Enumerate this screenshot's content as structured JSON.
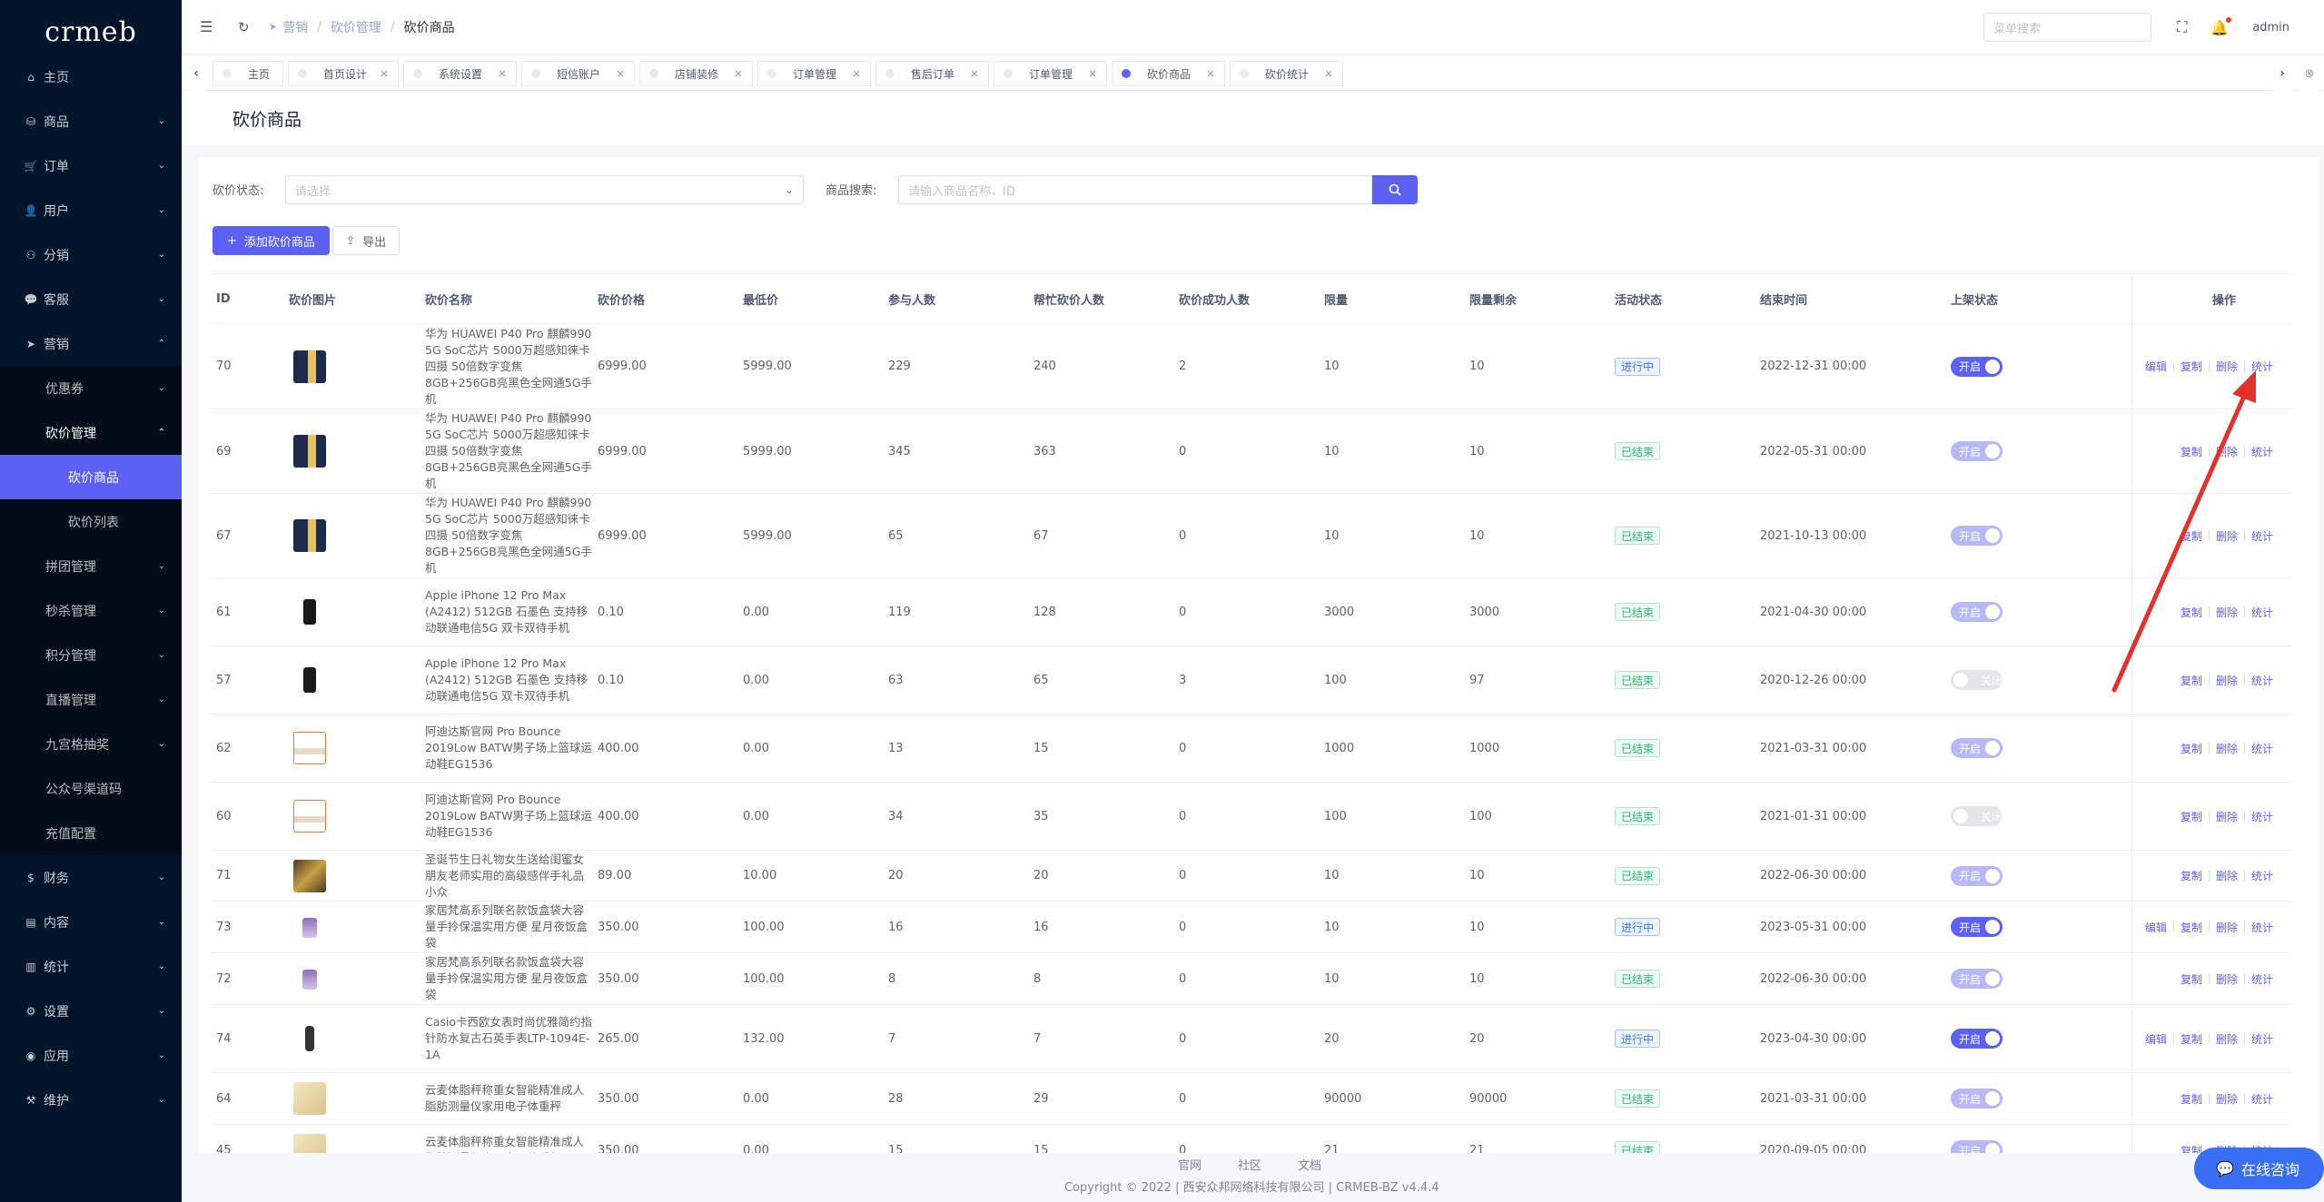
{
  "sidebar": {
    "logo": "crmeb",
    "items": [
      {
        "icon": "⌂",
        "label": "主页",
        "arrow": ""
      },
      {
        "icon": "⛁",
        "label": "商品",
        "arrow": "⌄"
      },
      {
        "icon": "🛒",
        "label": "订单",
        "arrow": "⌄"
      },
      {
        "icon": "👤",
        "label": "用户",
        "arrow": "⌄"
      },
      {
        "icon": "⚇",
        "label": "分销",
        "arrow": "⌄"
      },
      {
        "icon": "💬",
        "label": "客服",
        "arrow": "⌄"
      },
      {
        "icon": "➤",
        "label": "营销",
        "arrow": "⌃"
      }
    ],
    "marketing_sub": [
      {
        "label": "优惠券",
        "arrow": "⌄"
      },
      {
        "label": "砍价管理",
        "arrow": "⌃"
      }
    ],
    "bargain_sub": [
      {
        "label": "砍价商品"
      },
      {
        "label": "砍价列表"
      }
    ],
    "marketing_sub2": [
      {
        "label": "拼团管理",
        "arrow": "⌄"
      },
      {
        "label": "秒杀管理",
        "arrow": "⌄"
      },
      {
        "label": "积分管理",
        "arrow": "⌄"
      },
      {
        "label": "直播管理",
        "arrow": "⌄"
      },
      {
        "label": "九宫格抽奖",
        "arrow": "⌄"
      },
      {
        "label": "公众号渠道码",
        "arrow": ""
      },
      {
        "label": "充值配置",
        "arrow": ""
      }
    ],
    "items2": [
      {
        "icon": "$",
        "label": "财务",
        "arrow": "⌄"
      },
      {
        "icon": "▤",
        "label": "内容",
        "arrow": "⌄"
      },
      {
        "icon": "▥",
        "label": "统计",
        "arrow": "⌄"
      },
      {
        "icon": "⚙",
        "label": "设置",
        "arrow": "⌄"
      },
      {
        "icon": "◉",
        "label": "应用",
        "arrow": "⌄"
      },
      {
        "icon": "⚒",
        "label": "维护",
        "arrow": "⌄"
      }
    ]
  },
  "header": {
    "breadcrumb": [
      "营销",
      "砍价管理",
      "砍价商品"
    ],
    "menu_search_placeholder": "菜单搜索",
    "user": "admin"
  },
  "tabs": [
    {
      "label": "主页",
      "closable": false,
      "active": false
    },
    {
      "label": "首页设计",
      "closable": true,
      "active": false
    },
    {
      "label": "系统设置",
      "closable": true,
      "active": false
    },
    {
      "label": "短信账户",
      "closable": true,
      "active": false
    },
    {
      "label": "店铺装修",
      "closable": true,
      "active": false
    },
    {
      "label": "订单管理",
      "closable": true,
      "active": false
    },
    {
      "label": "售后订单",
      "closable": true,
      "active": false
    },
    {
      "label": "订单管理",
      "closable": true,
      "active": false
    },
    {
      "label": "砍价商品",
      "closable": true,
      "active": true
    },
    {
      "label": "砍价统计",
      "closable": true,
      "active": false
    }
  ],
  "page_title": "砍价商品",
  "filters": {
    "status_label": "砍价状态:",
    "status_placeholder": "请选择",
    "search_label": "商品搜索:",
    "search_placeholder": "请输入商品名称，ID"
  },
  "actions": {
    "add_label": "添加砍价商品",
    "export_label": "导出"
  },
  "table": {
    "headers": [
      "ID",
      "砍价图片",
      "砍价名称",
      "砍价价格",
      "最低价",
      "参与人数",
      "帮忙砍价人数",
      "砍价成功人数",
      "限量",
      "限量剩余",
      "活动状态",
      "结束时间",
      "上架状态",
      "操作"
    ],
    "rows": [
      {
        "id": "70",
        "img": "phone-p40",
        "name": "华为 HUAWEI P40 Pro 麒麟990 5G SoC芯片 5000万超感知徕卡四摄 50倍数字变焦 8GB+256GB亮黑色全网通5G手机",
        "price": "6999.00",
        "min": "5999.00",
        "people": "229",
        "helpers": "240",
        "success": "2",
        "limit": "10",
        "remain": "10",
        "status": "进行中",
        "status_color": "blue",
        "end": "2022-12-31 00:00",
        "switch": "开启",
        "switch_on": true,
        "switch_disabled": false,
        "ops": [
          "编辑",
          "复制",
          "删除",
          "统计"
        ],
        "h": 94
      },
      {
        "id": "69",
        "img": "phone-p40",
        "name": "华为 HUAWEI P40 Pro 麒麟990 5G SoC芯片 5000万超感知徕卡四摄 50倍数字变焦 8GB+256GB亮黑色全网通5G手机",
        "price": "6999.00",
        "min": "5999.00",
        "people": "345",
        "helpers": "363",
        "success": "0",
        "limit": "10",
        "remain": "10",
        "status": "已结束",
        "status_color": "green",
        "end": "2022-05-31 00:00",
        "switch": "开启",
        "switch_on": true,
        "switch_disabled": true,
        "ops": [
          "复制",
          "删除",
          "统计"
        ],
        "h": 93
      },
      {
        "id": "67",
        "img": "phone-p40",
        "name": "华为 HUAWEI P40 Pro 麒麟990 5G SoC芯片 5000万超感知徕卡四摄 50倍数字变焦 8GB+256GB亮黑色全网通5G手机",
        "price": "6999.00",
        "min": "5999.00",
        "people": "65",
        "helpers": "67",
        "success": "0",
        "limit": "10",
        "remain": "10",
        "status": "已结束",
        "status_color": "green",
        "end": "2021-10-13 00:00",
        "switch": "开启",
        "switch_on": true,
        "switch_disabled": true,
        "ops": [
          "复制",
          "删除",
          "统计"
        ],
        "h": 93
      },
      {
        "id": "61",
        "img": "phone-iphone",
        "name": "Apple iPhone 12 Pro Max (A2412) 512GB 石墨色 支持移动联通电信5G 双卡双待手机",
        "price": "0.10",
        "min": "0.00",
        "people": "119",
        "helpers": "128",
        "success": "0",
        "limit": "3000",
        "remain": "3000",
        "status": "已结束",
        "status_color": "green",
        "end": "2021-04-30 00:00",
        "switch": "开启",
        "switch_on": true,
        "switch_disabled": true,
        "ops": [
          "复制",
          "删除",
          "统计"
        ],
        "h": 75
      },
      {
        "id": "57",
        "img": "phone-iphone",
        "name": "Apple iPhone 12 Pro Max (A2412) 512GB 石墨色 支持移动联通电信5G 双卡双待手机",
        "price": "0.10",
        "min": "0.00",
        "people": "63",
        "helpers": "65",
        "success": "3",
        "limit": "100",
        "remain": "97",
        "status": "已结束",
        "status_color": "green",
        "end": "2020-12-26 00:00",
        "switch": "关闭",
        "switch_on": false,
        "switch_disabled": true,
        "ops": [
          "复制",
          "删除",
          "统计"
        ],
        "h": 75
      },
      {
        "id": "62",
        "img": "shoe",
        "name": "阿迪达斯官网 Pro Bounce 2019Low BATW男子场上篮球运动鞋EG1536",
        "price": "400.00",
        "min": "0.00",
        "people": "13",
        "helpers": "15",
        "success": "0",
        "limit": "1000",
        "remain": "1000",
        "status": "已结束",
        "status_color": "green",
        "end": "2021-03-31 00:00",
        "switch": "开启",
        "switch_on": true,
        "switch_disabled": true,
        "ops": [
          "复制",
          "删除",
          "统计"
        ],
        "h": 75
      },
      {
        "id": "60",
        "img": "shoe",
        "name": "阿迪达斯官网 Pro Bounce 2019Low BATW男子场上篮球运动鞋EG1536",
        "price": "400.00",
        "min": "0.00",
        "people": "34",
        "helpers": "35",
        "success": "0",
        "limit": "100",
        "remain": "100",
        "status": "已结束",
        "status_color": "green",
        "end": "2021-01-31 00:00",
        "switch": "关闭",
        "switch_on": false,
        "switch_disabled": true,
        "ops": [
          "复制",
          "删除",
          "统计"
        ],
        "h": 75
      },
      {
        "id": "71",
        "img": "gift",
        "name": "圣诞节生日礼物女生送给闺蜜女朋友老师实用的高级感伴手礼品小众",
        "price": "89.00",
        "min": "10.00",
        "people": "20",
        "helpers": "20",
        "success": "0",
        "limit": "10",
        "remain": "10",
        "status": "已结束",
        "status_color": "green",
        "end": "2022-06-30 00:00",
        "switch": "开启",
        "switch_on": true,
        "switch_disabled": true,
        "ops": [
          "复制",
          "删除",
          "统计"
        ],
        "h": 56
      },
      {
        "id": "73",
        "img": "bag",
        "name": "家居梵高系列联名款饭盒袋大容量手拎保温实用方便 星月夜饭盒袋",
        "price": "350.00",
        "min": "100.00",
        "people": "16",
        "helpers": "16",
        "success": "0",
        "limit": "10",
        "remain": "10",
        "status": "进行中",
        "status_color": "blue",
        "end": "2023-05-31 00:00",
        "switch": "开启",
        "switch_on": true,
        "switch_disabled": false,
        "ops": [
          "编辑",
          "复制",
          "删除",
          "统计"
        ],
        "h": 57
      },
      {
        "id": "72",
        "img": "bag",
        "name": "家居梵高系列联名款饭盒袋大容量手拎保温实用方便 星月夜饭盒袋",
        "price": "350.00",
        "min": "100.00",
        "people": "8",
        "helpers": "8",
        "success": "0",
        "limit": "10",
        "remain": "10",
        "status": "已结束",
        "status_color": "green",
        "end": "2022-06-30 00:00",
        "switch": "开启",
        "switch_on": true,
        "switch_disabled": true,
        "ops": [
          "复制",
          "删除",
          "统计"
        ],
        "h": 57
      },
      {
        "id": "74",
        "img": "watch",
        "name": "Casio卡西欧女表时尚优雅简约指针防水复古石英手表LTP-1094E-1A",
        "price": "265.00",
        "min": "132.00",
        "people": "7",
        "helpers": "7",
        "success": "0",
        "limit": "20",
        "remain": "20",
        "status": "进行中",
        "status_color": "blue",
        "end": "2023-04-30 00:00",
        "switch": "开启",
        "switch_on": true,
        "switch_disabled": false,
        "ops": [
          "编辑",
          "复制",
          "删除",
          "统计"
        ],
        "h": 75
      },
      {
        "id": "64",
        "img": "scale",
        "name": "云麦体脂秤称重女智能精准成人脂肪测量仪家用电子体重秤",
        "price": "350.00",
        "min": "0.00",
        "people": "28",
        "helpers": "29",
        "success": "0",
        "limit": "90000",
        "remain": "90000",
        "status": "已结束",
        "status_color": "green",
        "end": "2021-03-31 00:00",
        "switch": "开启",
        "switch_on": true,
        "switch_disabled": true,
        "ops": [
          "复制",
          "删除",
          "统计"
        ],
        "h": 57
      },
      {
        "id": "45",
        "img": "scale",
        "name": "云麦体脂秤称重女智能精准成人脂肪测量仪家用电子体重秤",
        "price": "350.00",
        "min": "0.00",
        "people": "15",
        "helpers": "15",
        "success": "0",
        "limit": "21",
        "remain": "21",
        "status": "已结束",
        "status_color": "green",
        "end": "2020-09-05 00:00",
        "switch": "开启",
        "switch_on": true,
        "switch_disabled": true,
        "ops": [
          "复制",
          "删除",
          "统计"
        ],
        "h": 57
      }
    ]
  },
  "footer": {
    "links": [
      "官网",
      "社区",
      "文档"
    ],
    "copyright": "Copyright © 2022 | 西安众邦网络科技有限公司 | CRMEB-BZ v4.4.4"
  },
  "consult": "在线咨询",
  "colors": {
    "accent": "#5d61f3",
    "sidebar": "#001529",
    "annotation": "#e5312b"
  }
}
